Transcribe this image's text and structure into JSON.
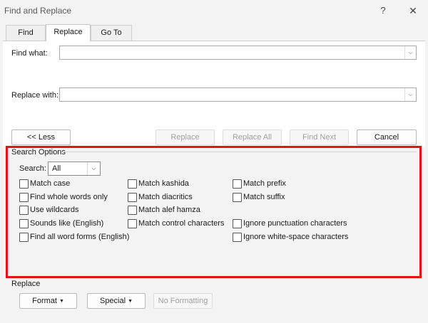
{
  "window": {
    "title": "Find and Replace",
    "help_glyph": "?",
    "close_glyph": "✕"
  },
  "tabs": [
    {
      "label": "Find",
      "active": false
    },
    {
      "label": "Replace",
      "active": true
    },
    {
      "label": "Go To",
      "active": false
    }
  ],
  "fields": {
    "find_label": "Find what:",
    "find_value": "",
    "replace_label": "Replace with:",
    "replace_value": ""
  },
  "buttons": {
    "less": "<< Less",
    "replace": "Replace",
    "replace_all": "Replace All",
    "find_next": "Find Next",
    "cancel": "Cancel"
  },
  "search_options": {
    "title": "Search Options",
    "search_label": "Search:",
    "search_value": "All",
    "col1": [
      {
        "label": "Match case",
        "checked": false
      },
      {
        "label": "Find whole words only",
        "checked": false
      },
      {
        "label": "Use wildcards",
        "checked": false
      },
      {
        "label": "Sounds like (English)",
        "checked": false
      },
      {
        "label": "Find all word forms (English)",
        "checked": false
      }
    ],
    "col2": [
      {
        "label": "Match kashida",
        "checked": false
      },
      {
        "label": "Match diacritics",
        "checked": false
      },
      {
        "label": "Match alef hamza",
        "checked": false
      },
      {
        "label": "Match control characters",
        "checked": false
      }
    ],
    "col3": [
      {
        "label": "Match prefix",
        "checked": false
      },
      {
        "label": "Match suffix",
        "checked": false
      },
      {
        "label": "Ignore punctuation characters",
        "checked": false
      },
      {
        "label": "Ignore white-space characters",
        "checked": false
      }
    ]
  },
  "replace_section": {
    "title": "Replace",
    "format_button": "Format",
    "special_button": "Special",
    "no_formatting_button": "No Formatting"
  },
  "colors": {
    "highlight_border": "#e3131b",
    "dialog_bg": "#f3f3f3"
  }
}
